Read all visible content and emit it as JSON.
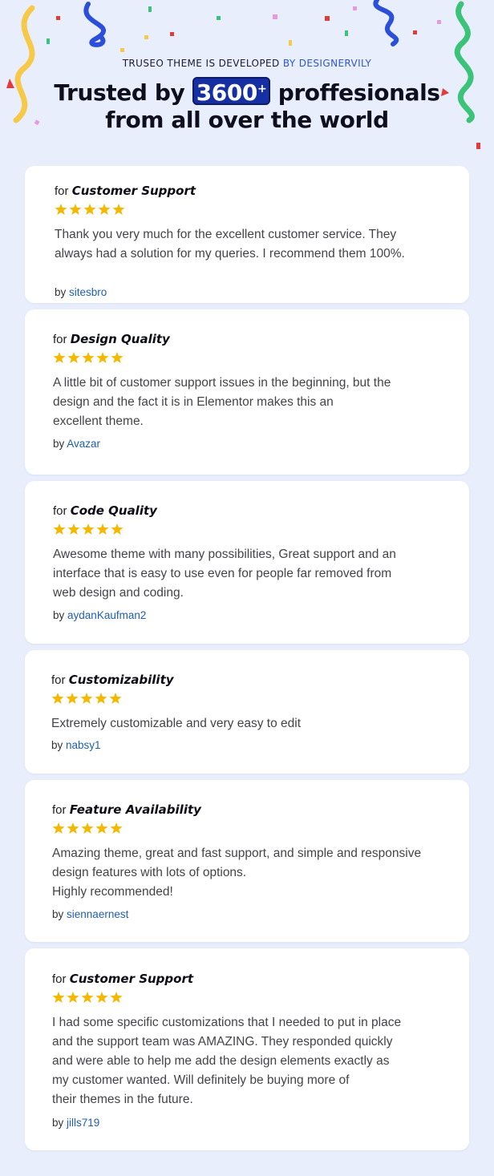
{
  "header": {
    "eyebrow_prefix": "TRUSEO THEME IS DEVELOPED",
    "eyebrow_brand": "BY DESIGNERVILY",
    "headline_prefix": "Trusted by",
    "count": "3600",
    "count_suffix": "+",
    "headline_suffix": "proffesionals",
    "headline_line2": "from all over the world"
  },
  "colors": {
    "accent": "#2b57d6",
    "count_bg": "#162fa3",
    "star": "#f5b800",
    "author": "#1f5fae",
    "background": "#e9eefc"
  },
  "reviews": [
    {
      "for_label": "for",
      "category": "Customer Support",
      "rating": 5,
      "text": "Thank you very much for the excellent customer service. They\nalways had a solution for my queries. I recommend them 100%.",
      "by_label": "by",
      "author": "sitesbro"
    },
    {
      "for_label": "for",
      "category": "Design Quality",
      "rating": 5,
      "text": "A little bit of customer support issues in the beginning, but the\ndesign and the fact it is in Elementor makes this an\nexcellent theme.",
      "by_label": "by",
      "author": "Avazar"
    },
    {
      "for_label": "for",
      "category": "Code Quality",
      "rating": 5,
      "text": "Awesome theme with many possibilities, Great support and an\ninterface that is easy to use even for people far removed from\nweb design and coding.",
      "by_label": "by",
      "author": "aydanKaufman2"
    },
    {
      "for_label": "for",
      "category": "Customizability",
      "rating": 5,
      "text": "Extremely customizable and very easy to edit",
      "by_label": "by",
      "author": "nabsy1"
    },
    {
      "for_label": "for",
      "category": "Feature Availability",
      "rating": 5,
      "text": "Amazing theme, great and fast support, and simple and responsive\ndesign features with lots of options.\nHighly recommended!",
      "by_label": "by",
      "author": "siennaernest"
    },
    {
      "for_label": "for",
      "category": "Customer Support",
      "rating": 5,
      "text": "I had some specific customizations that I needed to put in place\nand the support team was AMAZING. They responded quickly\nand were able to help me add the design elements exactly as\nmy customer wanted. Will definitely be buying more of\ntheir themes in the future.",
      "by_label": "by",
      "author": "jills719"
    }
  ]
}
